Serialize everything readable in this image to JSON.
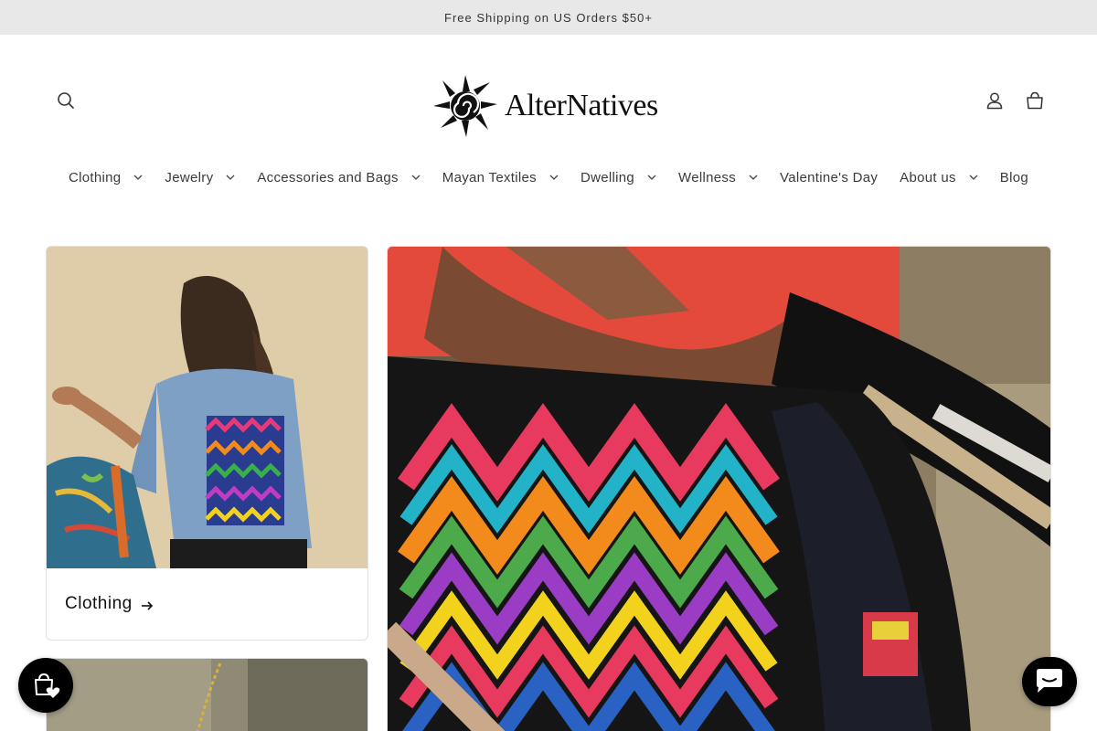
{
  "announcement": "Free Shipping on US Orders $50+",
  "brand": {
    "name": "AlterNatives"
  },
  "nav": {
    "items": [
      {
        "label": "Clothing",
        "dropdown": true
      },
      {
        "label": "Jewelry",
        "dropdown": true
      },
      {
        "label": "Accessories and Bags",
        "dropdown": true
      },
      {
        "label": "Mayan Textiles",
        "dropdown": true
      },
      {
        "label": "Dwelling",
        "dropdown": true
      },
      {
        "label": "Wellness",
        "dropdown": true
      },
      {
        "label": "Valentine's Day",
        "dropdown": false
      },
      {
        "label": "About us",
        "dropdown": true
      },
      {
        "label": "Blog",
        "dropdown": false
      }
    ]
  },
  "header_icons": {
    "search": "search-icon",
    "account": "account-icon",
    "cart": "cart-icon"
  },
  "collections": {
    "first": {
      "label": "Clothing",
      "arrow": "arrow-right-icon"
    }
  },
  "widgets": {
    "wishlist": "shopping-bag-heart-icon",
    "chat": "chat-icon"
  },
  "colors": {
    "announce_bg": "#e8e8e8",
    "text": "#121212",
    "fab": "#000000"
  }
}
